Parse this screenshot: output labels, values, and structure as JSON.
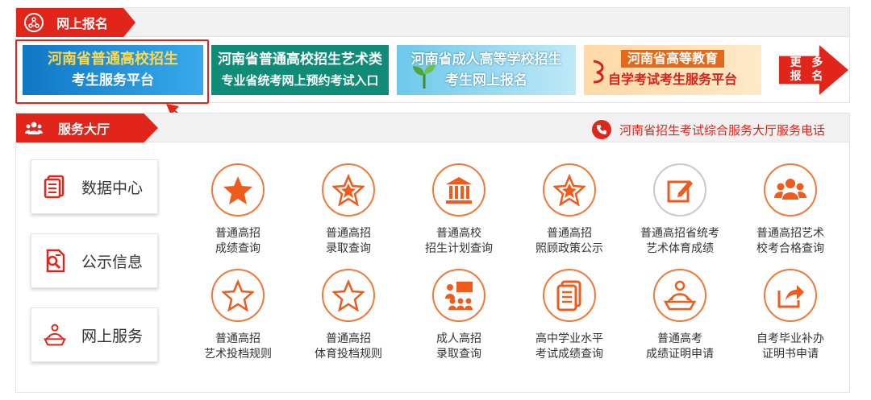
{
  "online": {
    "title": "网上报名",
    "icon": "network-icon",
    "banners": [
      {
        "line1": "河南省普通高校招生",
        "line2": "考生服务平台"
      },
      {
        "line1": "河南省普通高校招生艺术类",
        "line2": "专业省统考网上预约考试入口"
      },
      {
        "line1": "河南省成人高等学校招生",
        "line2": "考生网上报名"
      },
      {
        "line1": "河南省高等教育",
        "line2": "自学考试考生服务平台"
      }
    ],
    "more": {
      "line1": "更 多",
      "line2": "报 名"
    }
  },
  "service": {
    "title": "服务大厅",
    "icon": "people-icon",
    "phone_label": "河南省招生考试综合服务大厅服务电话",
    "phone_icon": "phone-icon",
    "side_buttons": [
      {
        "label": "数据中心",
        "icon": "document-stack-icon"
      },
      {
        "label": "公示信息",
        "icon": "document-search-icon"
      },
      {
        "label": "网上服务",
        "icon": "person-laptop-icon"
      }
    ],
    "tiles": [
      {
        "line1": "普通高招",
        "line2": "成绩查询",
        "icon": "star-filled-icon"
      },
      {
        "line1": "普通高招",
        "line2": "录取查询",
        "icon": "star-inner-icon"
      },
      {
        "line1": "普通高校",
        "line2": "招生计划查询",
        "icon": "bank-icon"
      },
      {
        "line1": "普通高招",
        "line2": "照顾政策公示",
        "icon": "star-inner-icon"
      },
      {
        "line1": "普通高招省统考",
        "line2": "艺术体育成绩",
        "icon": "edit-icon"
      },
      {
        "line1": "普通高招艺术",
        "line2": "校考合格查询",
        "icon": "group-icon"
      },
      {
        "line1": "普通高招",
        "line2": "艺术投档规则",
        "icon": "star-outline-icon"
      },
      {
        "line1": "普通高招",
        "line2": "体育投档规则",
        "icon": "star-outline-icon"
      },
      {
        "line1": "成人高招",
        "line2": "录取查询",
        "icon": "presentation-icon"
      },
      {
        "line1": "高中学业水平",
        "line2": "考试成绩查询",
        "icon": "document-stack-icon"
      },
      {
        "line1": "普通高考",
        "line2": "成绩证明申请",
        "icon": "person-laptop-icon"
      },
      {
        "line1": "自考毕业补办",
        "line2": "证明书申请",
        "icon": "share-icon"
      }
    ]
  },
  "colors": {
    "accent": "#e1251b",
    "tile_ring": "#ee7a3b"
  }
}
